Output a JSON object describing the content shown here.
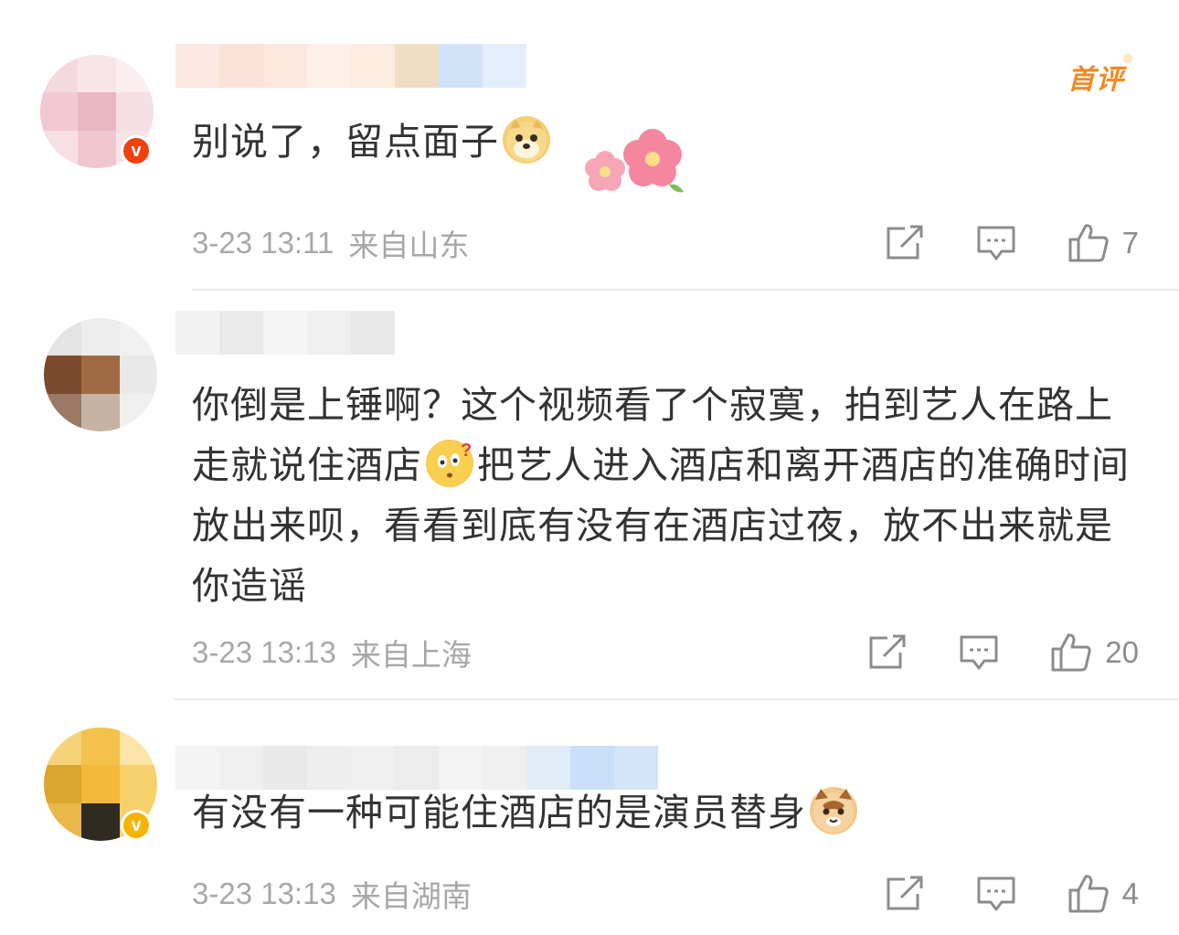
{
  "comments": [
    {
      "text_parts": [
        "别说了，留点面子"
      ],
      "emojis": [
        "doge-emoji"
      ],
      "time": "3-23 13:11",
      "location": "来自山东",
      "likes": "7",
      "first_comment_badge": "首评",
      "verified": true,
      "badge_color": "#f0400b",
      "badge_letter": "v"
    },
    {
      "text_parts": [
        "你倒是上锤啊？这个视频看了个寂寞，拍到艺人在路上走就说住酒店",
        "把艺人进入酒店和离开酒店的准确时间放出来呗，看看到底有没有在酒店过夜，放不出来就是你造谣"
      ],
      "emojis": [
        "confused-question-emoji"
      ],
      "time": "3-23 13:13",
      "location": "来自上海",
      "likes": "20",
      "verified": false
    },
    {
      "text_parts": [
        "有没有一种可能住酒店的是演员替身"
      ],
      "emojis": [
        "cat-emoji"
      ],
      "time": "3-23 13:13",
      "location": "来自湖南",
      "likes": "4",
      "verified": true,
      "badge_color": "#f7b500",
      "badge_letter": "v"
    }
  ],
  "icons": {
    "share": "share-icon",
    "comment": "comment-icon",
    "like": "like-icon"
  },
  "colors": {
    "meta_text": "#a7a7a7",
    "body_text": "#333333",
    "first_badge": "#f08a24",
    "divider": "#ececec"
  }
}
